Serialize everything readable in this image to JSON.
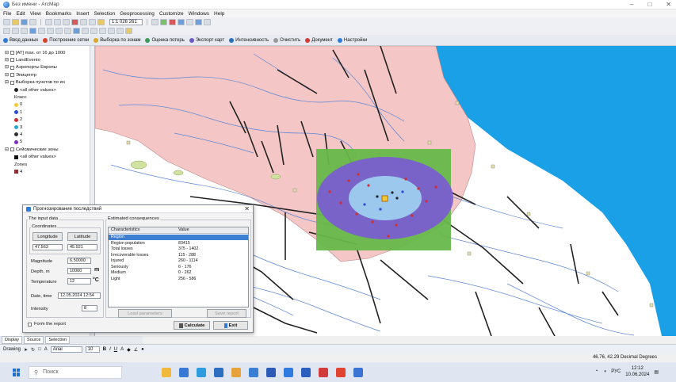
{
  "window": {
    "title": "Без имени - ArcMap"
  },
  "menu": [
    "File",
    "Edit",
    "View",
    "Bookmarks",
    "Insert",
    "Selection",
    "Geoprocessing",
    "Customize",
    "Windows",
    "Help"
  ],
  "toolbar": {
    "scale": "1:1 026 261",
    "zoom_value": ""
  },
  "plugin_toolbar": [
    {
      "label": "Ввод данных",
      "color": "#2f7bd6"
    },
    {
      "label": "Построение сетки",
      "color": "#d2432e"
    },
    {
      "label": "Выборка по зонам",
      "color": "#d8a829"
    },
    {
      "label": "Оценка потерь",
      "color": "#3a9a55"
    },
    {
      "label": "Экспорт карт",
      "color": "#6c5bc4"
    },
    {
      "label": "Интенсивность",
      "color": "#2b6fb8"
    },
    {
      "label": "Очистить",
      "color": "#999999"
    },
    {
      "label": "Документ",
      "color": "#d53a3a"
    },
    {
      "label": "Настройки",
      "color": "#2f7bd6"
    }
  ],
  "toc": {
    "items": [
      {
        "label": "[AT] max. от 16 до 1000",
        "type": "layer"
      },
      {
        "label": "LandEvento",
        "type": "layer"
      },
      {
        "label": "Аэропорты Европы",
        "type": "layer"
      },
      {
        "label": "Эпицентр",
        "type": "layer"
      },
      {
        "label": "Выборка пунктов по ин",
        "type": "layer"
      },
      {
        "label": "<all other values>",
        "type": "legend",
        "color": "#222222"
      },
      {
        "label": "Класс",
        "type": "heading"
      },
      {
        "label": "0",
        "type": "legend",
        "color": "#f2c83c"
      },
      {
        "label": "1",
        "type": "legend",
        "color": "#2b4fd0"
      },
      {
        "label": "2",
        "type": "legend",
        "color": "#d12f2f"
      },
      {
        "label": "3",
        "type": "legend",
        "color": "#2fa5d1"
      },
      {
        "label": "4",
        "type": "legend",
        "color": "#333333"
      },
      {
        "label": "5",
        "type": "legend",
        "color": "#7a2fb8"
      },
      {
        "label": "Сейсмические зоны",
        "type": "layer"
      },
      {
        "label": "<all other values>",
        "type": "legend",
        "color": "#111111"
      },
      {
        "label": "Zones",
        "type": "heading"
      },
      {
        "label": "4",
        "type": "legend",
        "color": "#8a3232"
      }
    ],
    "tabs": [
      "Display",
      "Source",
      "Selection"
    ]
  },
  "dialog": {
    "title": "Прогнозирование последствий",
    "input_group": "The input data",
    "coords_group": "Coordinates",
    "longitude_label": "Longitude",
    "latitude_label": "Latitude",
    "longitude_value": "47.563",
    "latitude_value": "45.921",
    "magnitude_label": "Magnitude",
    "magnitude_value": "6.50000",
    "depth_label": "Depth, m",
    "depth_value": "10000",
    "depth_unit": "m",
    "temperature_label": "Temperature",
    "temperature_value": "12",
    "temperature_unit": "°C",
    "datetime_label": "Date, time",
    "datetime_value": "12.05.2024 12:54",
    "intensity_label": "Intensity",
    "intensity_value": "8",
    "results_group": "Estimated consequences",
    "results_headers": [
      "Characteristics",
      "Value"
    ],
    "results": [
      {
        "name": "Region",
        "value": "",
        "selected": true
      },
      {
        "name": "Region population",
        "value": "83415"
      },
      {
        "name": "Total losses",
        "value": "375 - 1402"
      },
      {
        "name": "Irrecoverable losses",
        "value": "115 - 288"
      },
      {
        "name": "Injured",
        "value": "260 - 1114"
      },
      {
        "name": "Seriously",
        "value": "6 - 176"
      },
      {
        "name": "Medium",
        "value": "0 - 262"
      },
      {
        "name": "Light",
        "value": "256 - 586"
      }
    ],
    "btn_left": "Load parameters",
    "btn_right": "Save report",
    "check_label": "Form the report",
    "calc_label": "Calculate",
    "exit_label": "Exit"
  },
  "drawing": {
    "label": "Drawing",
    "font": "Arial",
    "size": "10"
  },
  "status": {
    "coords": "46.76, 42.29 Decimal Degrees"
  },
  "taskbar": {
    "search_placeholder": "Поиск",
    "lang": "РУС",
    "time": "12:12",
    "date": "10.06.2024",
    "apps": [
      "#f0b93a",
      "#3a78d6",
      "#2d9de0",
      "#2c6fc1",
      "#e6a23b",
      "#3a7fd6",
      "#2d5ab5",
      "#2f7be0",
      "#2a5fbf",
      "#d23b3b",
      "#e0442e",
      "#3b74d2"
    ]
  }
}
